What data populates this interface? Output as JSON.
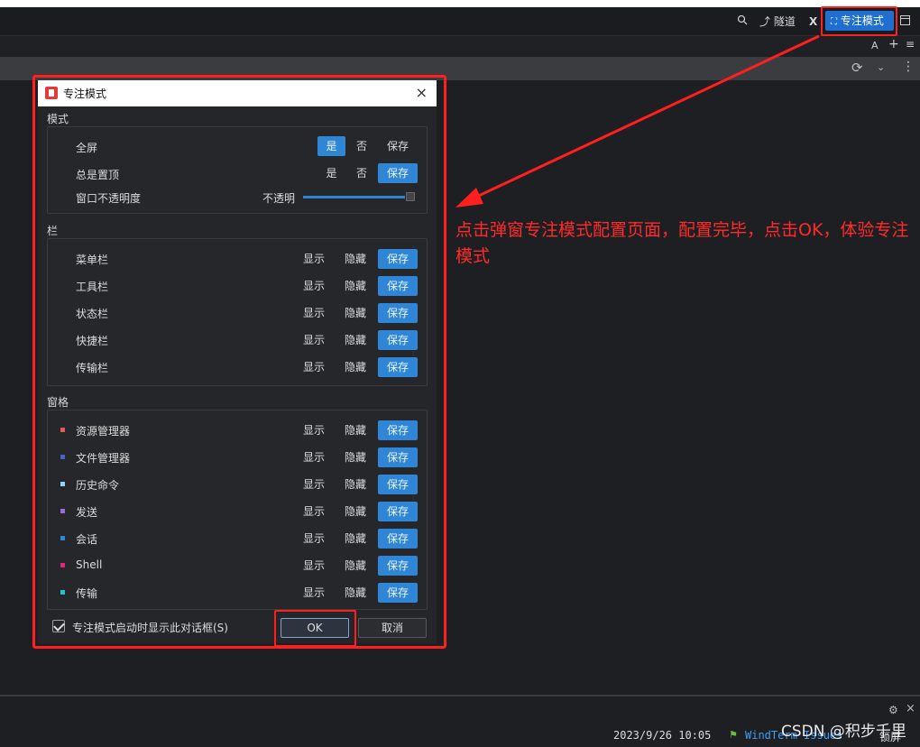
{
  "titlebar": {
    "search_icon": "search-icon",
    "tunnel_label": "隧道",
    "x_label": "X",
    "focus_mode_label": "专注模式",
    "window_icon": "window-icon"
  },
  "row2": {
    "font_label": "A",
    "plus_label": "+",
    "menu_label": "≡"
  },
  "dialog": {
    "title": "专注模式",
    "close_label": "×",
    "mode_section": {
      "label": "模式",
      "rows": [
        {
          "label": "全屏",
          "options": [
            "是",
            "否",
            "保存"
          ],
          "selected": "是"
        },
        {
          "label": "总是置顶",
          "options": [
            "是",
            "否",
            "保存"
          ],
          "selected": "保存"
        }
      ],
      "opacity": {
        "label": "窗口不透明度",
        "value_label": "不透明",
        "level": 1.0
      }
    },
    "bar_section": {
      "label": "栏",
      "rows": [
        {
          "label": "菜单栏",
          "show": "显示",
          "hide": "隐藏",
          "save": "保存"
        },
        {
          "label": "工具栏",
          "show": "显示",
          "hide": "隐藏",
          "save": "保存"
        },
        {
          "label": "状态栏",
          "show": "显示",
          "hide": "隐藏",
          "save": "保存"
        },
        {
          "label": "快捷栏",
          "show": "显示",
          "hide": "隐藏",
          "save": "保存"
        },
        {
          "label": "传输栏",
          "show": "显示",
          "hide": "隐藏",
          "save": "保存"
        }
      ]
    },
    "pane_section": {
      "label": "窗格",
      "rows": [
        {
          "label": "资源管理器",
          "color": "#e05a5a",
          "show": "显示",
          "hide": "隐藏",
          "save": "保存"
        },
        {
          "label": "文件管理器",
          "color": "#4a5fd0",
          "show": "显示",
          "hide": "隐藏",
          "save": "保存"
        },
        {
          "label": "历史命令",
          "color": "#8fd6f2",
          "show": "显示",
          "hide": "隐藏",
          "save": "保存"
        },
        {
          "label": "发送",
          "color": "#9a6cd6",
          "show": "显示",
          "hide": "隐藏",
          "save": "保存"
        },
        {
          "label": "会话",
          "color": "#2f86e0",
          "show": "显示",
          "hide": "隐藏",
          "save": "保存"
        },
        {
          "label": "Shell",
          "color": "#e0257a",
          "show": "显示",
          "hide": "隐藏",
          "save": "保存"
        },
        {
          "label": "传输",
          "color": "#21c7c7",
          "show": "显示",
          "hide": "隐藏",
          "save": "保存"
        }
      ]
    },
    "footer": {
      "checkbox_label": "专注模式启动时显示此对话框(S)",
      "checked": true,
      "ok_label": "OK",
      "cancel_label": "取消"
    }
  },
  "annotation": {
    "text": "点击弹窗专注模式配置页面，配置完毕，点击OK，体验专注模式"
  },
  "statusbar": {
    "datetime": "2023/9/26 10:05",
    "issues_label": "WindTerm Issues",
    "lock_label": "锁屏",
    "settings_icon": "gear-icon",
    "close_label": "×"
  },
  "watermark": "CSDN @积步千里"
}
